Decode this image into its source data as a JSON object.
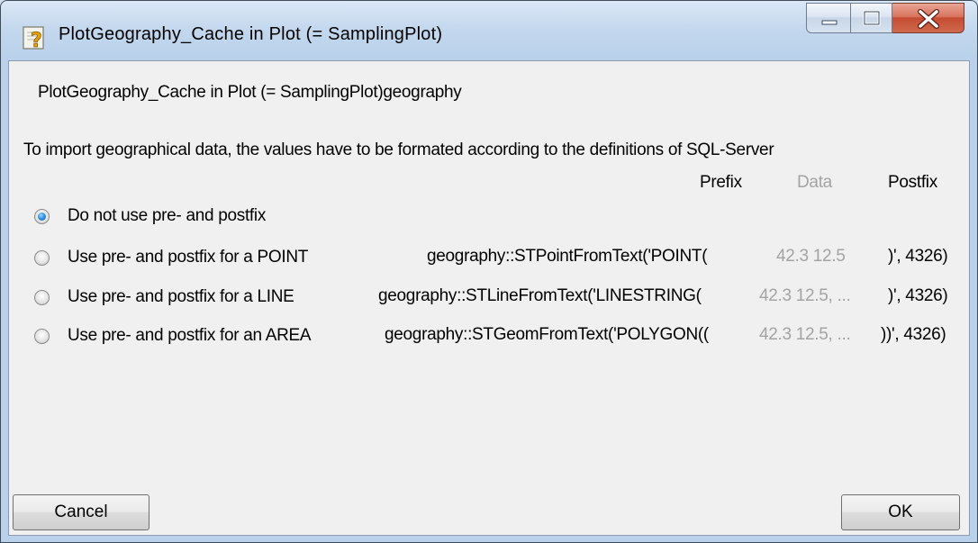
{
  "window": {
    "title": "PlotGeography_Cache in Plot (= SamplingPlot)",
    "icon": "help-question-icon"
  },
  "header_text": "PlotGeography_Cache in Plot (= SamplingPlot)geography",
  "info_text": "To import geographical data, the values have to be formated according to the definitions of SQL-Server",
  "columns": {
    "prefix": "Prefix",
    "data": "Data",
    "postfix": "Postfix"
  },
  "options": [
    {
      "label": "Do not use pre- and postfix",
      "checked": true,
      "prefix": "",
      "data": "",
      "postfix": ""
    },
    {
      "label": "Use pre- and postfix for a POINT",
      "checked": false,
      "prefix": "geography::STPointFromText('POINT(",
      "data": "42.3 12.5",
      "postfix": ")', 4326)"
    },
    {
      "label": "Use pre- and postfix for a LINE",
      "checked": false,
      "prefix": "geography::STLineFromText('LINESTRING(",
      "data": "42.3 12.5, ...",
      "postfix": ")', 4326)"
    },
    {
      "label": "Use pre- and postfix for an AREA",
      "checked": false,
      "prefix": "geography::STGeomFromText('POLYGON((",
      "data": "42.3 12.5, ...",
      "postfix": "))', 4326)"
    }
  ],
  "buttons": {
    "cancel": "Cancel",
    "ok": "OK"
  }
}
